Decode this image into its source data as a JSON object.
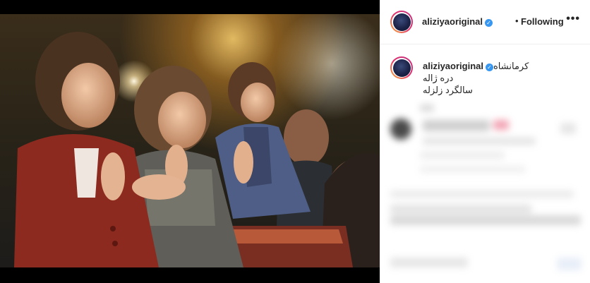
{
  "post": {
    "author": "aliziyaoriginal",
    "follow_status": "Following",
    "separator": "•",
    "more_icon": "•••",
    "verified_icon": "✓",
    "caption_lines": [
      "کرمانشاه",
      "دره ژاله",
      "سالگرد زلزله"
    ]
  },
  "icons": [
    "avatar",
    "verified-badge-icon",
    "more-options-icon"
  ],
  "colors": {
    "accent": "#3897f0",
    "border": "#efefef",
    "text": "#262626"
  }
}
